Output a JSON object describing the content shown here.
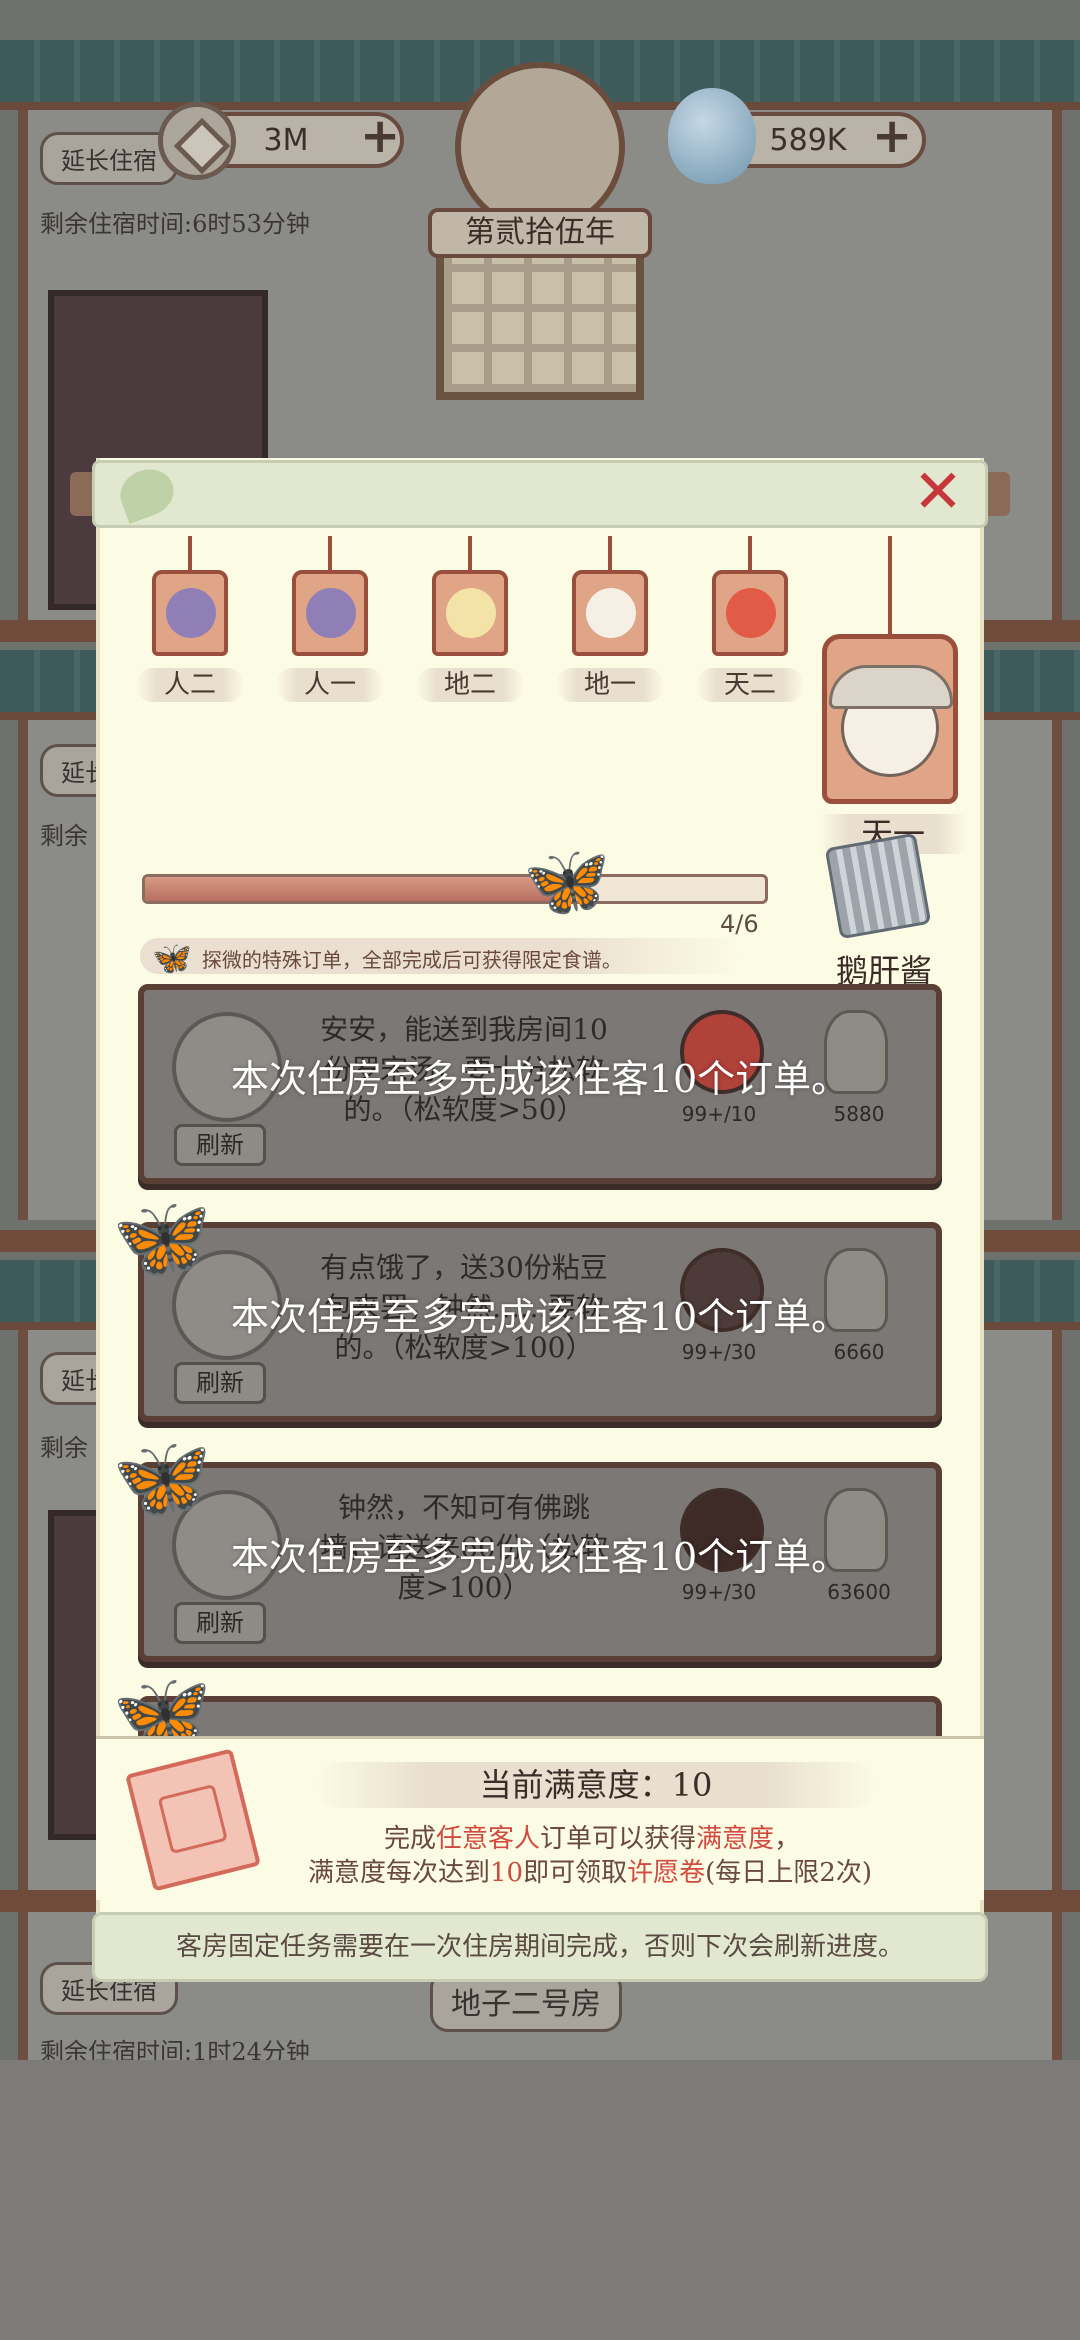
{
  "hud": {
    "coins": "3M",
    "spirit": "589K",
    "plus": "+",
    "year": "第贰拾伍年"
  },
  "scene": {
    "extend_label": "延长住宿",
    "extend_short": "延长",
    "room_partial": "房",
    "remaining_prefix": "剩余",
    "timer_top": "剩余住宿时间:6时53分钟",
    "timer_bottom": "剩余住宿时间:1时24分钟",
    "room_bottom": "地子二号房"
  },
  "panel": {
    "close": "✕",
    "tags": [
      {
        "label": "人二",
        "face_color": "#8f7fb6"
      },
      {
        "label": "人一",
        "face_color": "#8f7fb6"
      },
      {
        "label": "地二",
        "face_color": "#f4e3a6"
      },
      {
        "label": "地一",
        "face_color": "#f6efe6"
      },
      {
        "label": "天二",
        "face_color": "#e25b46"
      }
    ],
    "featured_label": "天一",
    "progress": {
      "current": 4,
      "total": 6,
      "text": "4/6",
      "fraction": 0.6667
    },
    "reward_name": "鹅肝酱",
    "hint": "探微的特殊订单，全部完成后可获得限定食谱。",
    "orders": [
      {
        "text": "安安，能送到我房间10份罗宋汤，要十分松软的。（松软度>50）",
        "refresh": "刷新",
        "dish_color": "#b0423a",
        "count": "99+/10",
        "reward_value": "5880",
        "overlay": "本次住房至多完成该住客10个订单。"
      },
      {
        "text": "有点饿了，送30份粘豆包来罢，钟然……要软的。（松软度>100）",
        "refresh": "刷新",
        "dish_color": "#4d3b3a",
        "count": "99+/30",
        "reward_value": "6660",
        "overlay": "本次住房至多完成该住客10个订单。"
      },
      {
        "text": "钟然，不知可有佛跳墙，请送来60份（松软度>100）",
        "refresh": "刷新",
        "dish_color": "#3e2a26",
        "count": "99+/30",
        "reward_value": "63600",
        "overlay": "本次住房至多完成该住客10个订单。"
      }
    ],
    "satisfaction": {
      "title": "当前满意度：10",
      "line1_a": "完成",
      "line1_hl1": "任意客人",
      "line1_b": "订单可以获得",
      "line1_hl2": "满意度",
      "line1_c": "，",
      "line2_a": "满意度每次达到",
      "line2_hl1": "10",
      "line2_b": "即可领取",
      "line2_hl2": "许愿卷",
      "line2_c": "(每日上限2次)"
    },
    "notice": "客房固定任务需要在一次住房期间完成，否则下次会刷新进度。"
  },
  "colors": {
    "panel_bg": "#fcfbe3",
    "accent_red": "#c6363a",
    "butterfly": "#f2b06a",
    "frame_brown": "#5a3f36"
  }
}
